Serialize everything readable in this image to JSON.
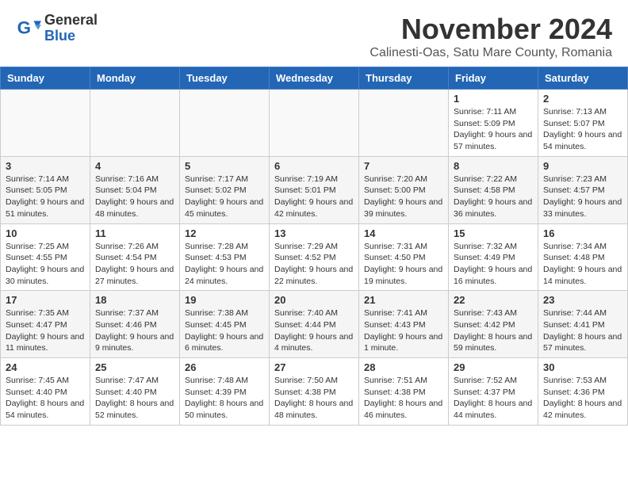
{
  "header": {
    "logo_general": "General",
    "logo_blue": "Blue",
    "month_title": "November 2024",
    "location": "Calinesti-Oas, Satu Mare County, Romania"
  },
  "weekdays": [
    "Sunday",
    "Monday",
    "Tuesday",
    "Wednesday",
    "Thursday",
    "Friday",
    "Saturday"
  ],
  "weeks": [
    [
      {
        "day": "",
        "info": ""
      },
      {
        "day": "",
        "info": ""
      },
      {
        "day": "",
        "info": ""
      },
      {
        "day": "",
        "info": ""
      },
      {
        "day": "",
        "info": ""
      },
      {
        "day": "1",
        "info": "Sunrise: 7:11 AM\nSunset: 5:09 PM\nDaylight: 9 hours and 57 minutes."
      },
      {
        "day": "2",
        "info": "Sunrise: 7:13 AM\nSunset: 5:07 PM\nDaylight: 9 hours and 54 minutes."
      }
    ],
    [
      {
        "day": "3",
        "info": "Sunrise: 7:14 AM\nSunset: 5:05 PM\nDaylight: 9 hours and 51 minutes."
      },
      {
        "day": "4",
        "info": "Sunrise: 7:16 AM\nSunset: 5:04 PM\nDaylight: 9 hours and 48 minutes."
      },
      {
        "day": "5",
        "info": "Sunrise: 7:17 AM\nSunset: 5:02 PM\nDaylight: 9 hours and 45 minutes."
      },
      {
        "day": "6",
        "info": "Sunrise: 7:19 AM\nSunset: 5:01 PM\nDaylight: 9 hours and 42 minutes."
      },
      {
        "day": "7",
        "info": "Sunrise: 7:20 AM\nSunset: 5:00 PM\nDaylight: 9 hours and 39 minutes."
      },
      {
        "day": "8",
        "info": "Sunrise: 7:22 AM\nSunset: 4:58 PM\nDaylight: 9 hours and 36 minutes."
      },
      {
        "day": "9",
        "info": "Sunrise: 7:23 AM\nSunset: 4:57 PM\nDaylight: 9 hours and 33 minutes."
      }
    ],
    [
      {
        "day": "10",
        "info": "Sunrise: 7:25 AM\nSunset: 4:55 PM\nDaylight: 9 hours and 30 minutes."
      },
      {
        "day": "11",
        "info": "Sunrise: 7:26 AM\nSunset: 4:54 PM\nDaylight: 9 hours and 27 minutes."
      },
      {
        "day": "12",
        "info": "Sunrise: 7:28 AM\nSunset: 4:53 PM\nDaylight: 9 hours and 24 minutes."
      },
      {
        "day": "13",
        "info": "Sunrise: 7:29 AM\nSunset: 4:52 PM\nDaylight: 9 hours and 22 minutes."
      },
      {
        "day": "14",
        "info": "Sunrise: 7:31 AM\nSunset: 4:50 PM\nDaylight: 9 hours and 19 minutes."
      },
      {
        "day": "15",
        "info": "Sunrise: 7:32 AM\nSunset: 4:49 PM\nDaylight: 9 hours and 16 minutes."
      },
      {
        "day": "16",
        "info": "Sunrise: 7:34 AM\nSunset: 4:48 PM\nDaylight: 9 hours and 14 minutes."
      }
    ],
    [
      {
        "day": "17",
        "info": "Sunrise: 7:35 AM\nSunset: 4:47 PM\nDaylight: 9 hours and 11 minutes."
      },
      {
        "day": "18",
        "info": "Sunrise: 7:37 AM\nSunset: 4:46 PM\nDaylight: 9 hours and 9 minutes."
      },
      {
        "day": "19",
        "info": "Sunrise: 7:38 AM\nSunset: 4:45 PM\nDaylight: 9 hours and 6 minutes."
      },
      {
        "day": "20",
        "info": "Sunrise: 7:40 AM\nSunset: 4:44 PM\nDaylight: 9 hours and 4 minutes."
      },
      {
        "day": "21",
        "info": "Sunrise: 7:41 AM\nSunset: 4:43 PM\nDaylight: 9 hours and 1 minute."
      },
      {
        "day": "22",
        "info": "Sunrise: 7:43 AM\nSunset: 4:42 PM\nDaylight: 8 hours and 59 minutes."
      },
      {
        "day": "23",
        "info": "Sunrise: 7:44 AM\nSunset: 4:41 PM\nDaylight: 8 hours and 57 minutes."
      }
    ],
    [
      {
        "day": "24",
        "info": "Sunrise: 7:45 AM\nSunset: 4:40 PM\nDaylight: 8 hours and 54 minutes."
      },
      {
        "day": "25",
        "info": "Sunrise: 7:47 AM\nSunset: 4:40 PM\nDaylight: 8 hours and 52 minutes."
      },
      {
        "day": "26",
        "info": "Sunrise: 7:48 AM\nSunset: 4:39 PM\nDaylight: 8 hours and 50 minutes."
      },
      {
        "day": "27",
        "info": "Sunrise: 7:50 AM\nSunset: 4:38 PM\nDaylight: 8 hours and 48 minutes."
      },
      {
        "day": "28",
        "info": "Sunrise: 7:51 AM\nSunset: 4:38 PM\nDaylight: 8 hours and 46 minutes."
      },
      {
        "day": "29",
        "info": "Sunrise: 7:52 AM\nSunset: 4:37 PM\nDaylight: 8 hours and 44 minutes."
      },
      {
        "day": "30",
        "info": "Sunrise: 7:53 AM\nSunset: 4:36 PM\nDaylight: 8 hours and 42 minutes."
      }
    ]
  ]
}
